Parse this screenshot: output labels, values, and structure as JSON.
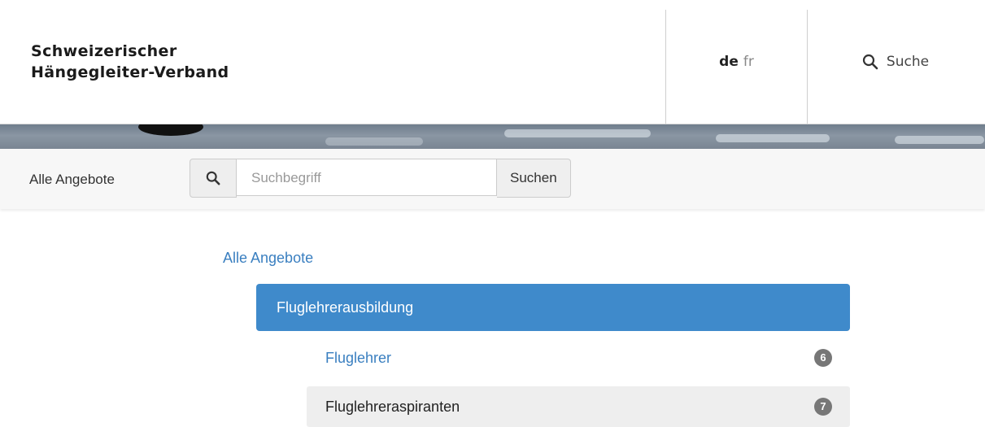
{
  "header": {
    "logo_line1": "Schweizerischer",
    "logo_line2": "Hängegleiter-Verband",
    "lang_active": "de",
    "lang_other": "fr",
    "search_label": "Suche"
  },
  "toolbar": {
    "label": "Alle Angebote",
    "search_placeholder": "Suchbegriff",
    "search_button": "Suchen"
  },
  "list": {
    "all_link": "Alle Angebote",
    "active_category": "Fluglehrerausbildung",
    "items": [
      {
        "label": "Fluglehrer",
        "count": "6"
      },
      {
        "label": "Fluglehreraspiranten",
        "count": "7"
      }
    ]
  },
  "colors": {
    "accent": "#3f8acb",
    "link": "#3a7fc0",
    "badge": "#777777"
  }
}
